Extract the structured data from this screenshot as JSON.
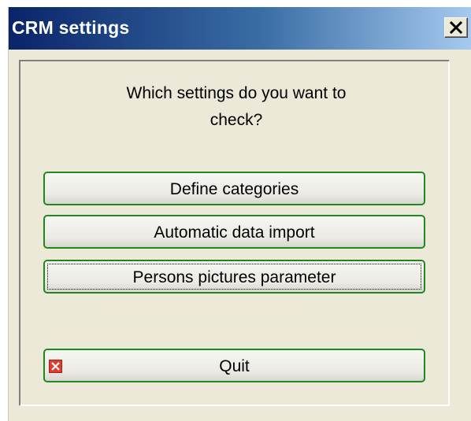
{
  "window": {
    "title": "CRM settings",
    "close_icon": "close-icon"
  },
  "dialog": {
    "question_line1": "Which settings do you want to",
    "question_line2": "check?",
    "buttons": [
      {
        "label": "Define categories"
      },
      {
        "label": "Automatic data import"
      },
      {
        "label": "Persons pictures parameter",
        "focused": true
      }
    ],
    "quit": {
      "label": "Quit",
      "icon": "quit-x-icon"
    }
  },
  "colors": {
    "title_gradient_start": "#0a246a",
    "title_gradient_end": "#a6caf0",
    "button_border": "#1e8a1e",
    "quit_icon_red": "#e03c2c"
  }
}
